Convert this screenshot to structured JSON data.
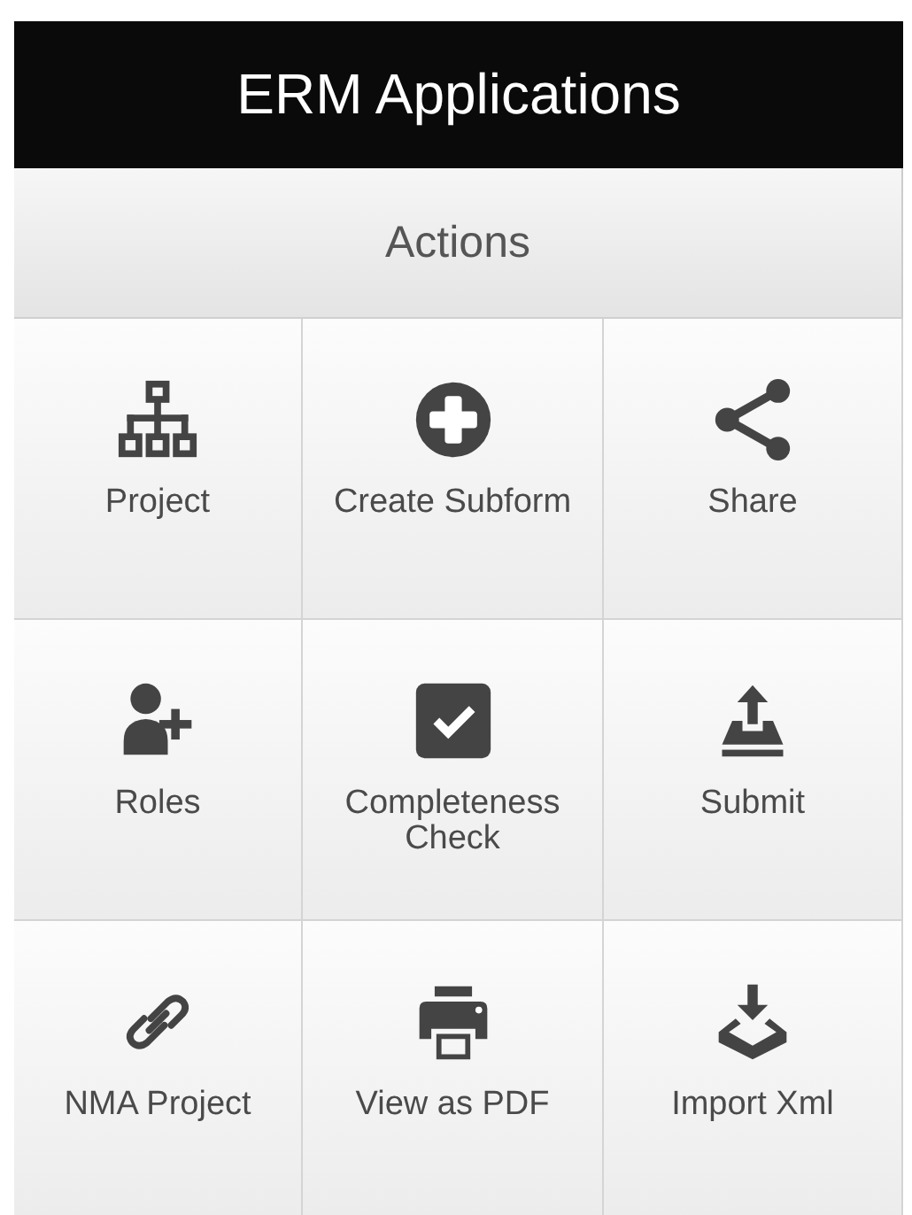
{
  "header": {
    "title": "ERM Applications"
  },
  "panel": {
    "title": "Actions"
  },
  "actions": [
    {
      "label": "Project",
      "kind": "hierarchy"
    },
    {
      "label": "Create Subform",
      "kind": "plus"
    },
    {
      "label": "Share",
      "kind": "share"
    },
    {
      "label": "Roles",
      "kind": "user-plus"
    },
    {
      "label": "Completeness Check",
      "kind": "check"
    },
    {
      "label": "Submit",
      "kind": "upload"
    },
    {
      "label": "NMA Project",
      "kind": "link"
    },
    {
      "label": "View as PDF",
      "kind": "print"
    },
    {
      "label": "Import Xml",
      "kind": "download"
    }
  ]
}
